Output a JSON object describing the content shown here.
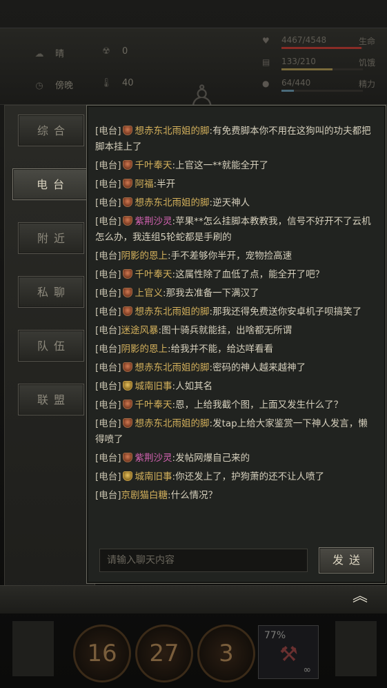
{
  "hud": {
    "weather": {
      "icon": "cloud-sun-icon",
      "label": "晴"
    },
    "radiation": {
      "icon": "radiation-icon",
      "value": "0"
    },
    "time": {
      "icon": "clock-icon",
      "label": "傍晚"
    },
    "temperature": {
      "icon": "thermometer-icon",
      "value": "40"
    },
    "bars": [
      {
        "icon": "heart-icon",
        "value": "4467/4548",
        "label": "生命",
        "fill": 0.98,
        "color": "#8a2c26"
      },
      {
        "icon": "food-icon",
        "value": "133/210",
        "label": "饥饿",
        "fill": 0.63,
        "color": "#7a6a3a"
      },
      {
        "icon": "water-icon",
        "value": "64/440",
        "label": "精力",
        "fill": 0.15,
        "color": "#4a6a7a"
      }
    ]
  },
  "tabs": [
    {
      "label": "综合",
      "active": false
    },
    {
      "label": "电台",
      "active": true
    },
    {
      "label": "附近",
      "active": false
    },
    {
      "label": "私聊",
      "active": false
    },
    {
      "label": "队伍",
      "active": false
    },
    {
      "label": "联盟",
      "active": false
    }
  ],
  "chat": {
    "messages": [
      {
        "channel": "[电台]",
        "badge": "red",
        "name": "想赤东北雨姐的脚",
        "name_color": "gold",
        "text": ":有免费脚本你不用在这狗叫的功夫都把脚本挂上了"
      },
      {
        "channel": "[电台]",
        "badge": "red",
        "name": "千叶奉天",
        "name_color": "gold",
        "text": ":上官这一**就能全开了"
      },
      {
        "channel": "[电台]",
        "badge": "red",
        "name": "阿福",
        "name_color": "gold",
        "text": ":半开"
      },
      {
        "channel": "[电台]",
        "badge": "red",
        "name": "想赤东北雨姐的脚",
        "name_color": "gold",
        "text": ":逆天神人"
      },
      {
        "channel": "[电台]",
        "badge": "red",
        "name": "紫荆沙灵",
        "name_color": "pink",
        "text": ":苹果**怎么挂脚本教教我，信号不好开不了云机怎么办，我连组5轮蛇都是手刷的"
      },
      {
        "channel": "[电台]",
        "badge": "none",
        "name": "阴影的恩上",
        "name_color": "gold",
        "text": ":手不差够你半开，宠物捡高速"
      },
      {
        "channel": "[电台]",
        "badge": "red",
        "name": "千叶奉天",
        "name_color": "gold",
        "text": ":这属性除了血低了点，能全开了吧？"
      },
      {
        "channel": "[电台]",
        "badge": "red",
        "name": "上官义",
        "name_color": "gold",
        "text": ":那我去准备一下满汉了"
      },
      {
        "channel": "[电台]",
        "badge": "red",
        "name": "想赤东北雨姐的脚",
        "name_color": "gold",
        "text": ":那我还得免费送你安卓机子呗搞笑了"
      },
      {
        "channel": "[电台]",
        "badge": "none",
        "name": "迷途风暴",
        "name_color": "gold",
        "text": ":图十骑兵就能挂，出啥都无所谓"
      },
      {
        "channel": "[电台]",
        "badge": "none",
        "name": "阴影的恩上",
        "name_color": "gold",
        "text": ":给我并不能，给达咩看看"
      },
      {
        "channel": "[电台]",
        "badge": "red",
        "name": "想赤东北雨姐的脚",
        "name_color": "gold",
        "text": ":密码的神人越来越神了"
      },
      {
        "channel": "[电台]",
        "badge": "gold",
        "name": "城南旧事",
        "name_color": "gold",
        "text": ":人如其名"
      },
      {
        "channel": "[电台]",
        "badge": "red",
        "name": "千叶奉天",
        "name_color": "gold",
        "text": ":恩，上给我截个图，上面又发生什么了？"
      },
      {
        "channel": "[电台]",
        "badge": "red",
        "name": "想赤东北雨姐的脚",
        "name_color": "gold",
        "text": ":发tap上给大家鉴赏一下神人发言，懒得喷了"
      },
      {
        "channel": "[电台]",
        "badge": "red",
        "name": "紫荆沙灵",
        "name_color": "pink",
        "text": ":发帖网爆自己来的"
      },
      {
        "channel": "[电台]",
        "badge": "gold",
        "name": "城南旧事",
        "name_color": "gold",
        "text": ":你还发上了，护狗萧的还不让人喷了"
      },
      {
        "channel": "[电台]",
        "badge": "none",
        "name": "京剧猫白糖",
        "name_color": "gold",
        "text": ":什么情况？"
      }
    ],
    "input_placeholder": "请输入聊天内容",
    "send_label": "发送"
  },
  "bottom": {
    "collapse_icon": "double-chevron-up-icon",
    "skills": [
      "16",
      "27",
      "3"
    ],
    "slot_percent": "77%",
    "slot_infinite": "∞"
  }
}
